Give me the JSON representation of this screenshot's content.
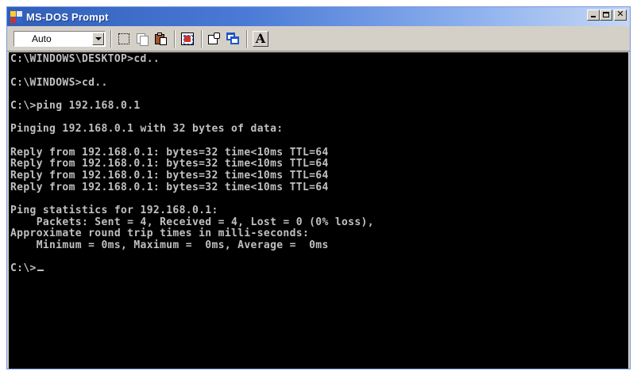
{
  "window": {
    "title": "MS-DOS Prompt",
    "title_bar_color": "#2f5fb8",
    "console_background": "#000000",
    "console_text_color": "#c0c0c0"
  },
  "toolbar": {
    "font_size_select": "Auto",
    "buttons": [
      {
        "name": "mark",
        "icon": "mark-icon"
      },
      {
        "name": "copy",
        "icon": "copy-icon"
      },
      {
        "name": "paste",
        "icon": "paste-icon"
      },
      {
        "name": "full-screen",
        "icon": "full-screen-icon"
      },
      {
        "name": "properties",
        "icon": "properties-icon"
      },
      {
        "name": "background",
        "icon": "background-icon"
      },
      {
        "name": "font",
        "icon": "font-icon",
        "label": "A"
      }
    ]
  },
  "console": {
    "lines": [
      "C:\\WINDOWS\\DESKTOP>cd..",
      "",
      "C:\\WINDOWS>cd..",
      "",
      "C:\\>ping 192.168.0.1",
      "",
      "Pinging 192.168.0.1 with 32 bytes of data:",
      "",
      "Reply from 192.168.0.1: bytes=32 time<10ms TTL=64",
      "Reply from 192.168.0.1: bytes=32 time<10ms TTL=64",
      "Reply from 192.168.0.1: bytes=32 time<10ms TTL=64",
      "Reply from 192.168.0.1: bytes=32 time<10ms TTL=64",
      "",
      "Ping statistics for 192.168.0.1:",
      "    Packets: Sent = 4, Received = 4, Lost = 0 (0% loss),",
      "Approximate round trip times in milli-seconds:",
      "    Minimum = 0ms, Maximum =  0ms, Average =  0ms",
      "",
      "C:\\>"
    ]
  }
}
